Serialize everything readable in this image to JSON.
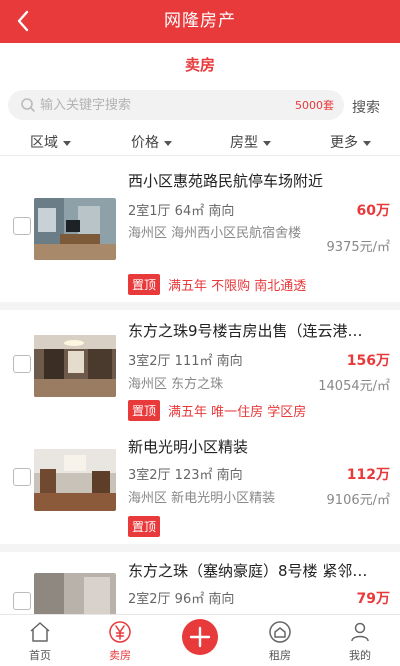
{
  "header": {
    "title": "网隆房产"
  },
  "section_title": "卖房",
  "search": {
    "placeholder": "输入关键字搜索",
    "count": "5000套",
    "button": "搜索"
  },
  "filters": [
    {
      "label": "区域"
    },
    {
      "label": "价格"
    },
    {
      "label": "房型"
    },
    {
      "label": "更多"
    }
  ],
  "listings": [
    {
      "title": "西小区惠苑路民航停车场附近",
      "specs": "2室1厅 64㎡ 南向",
      "price": "60万",
      "location": "海州区 海州西小区民航宿舍楼",
      "unit_price": "9375元/㎡",
      "badge": "置顶",
      "tags": "满五年 不限购 南北通透"
    },
    {
      "title": "东方之珠9号楼吉房出售（连云港…",
      "specs": "3室2厅 111㎡ 南向",
      "price": "156万",
      "location": "海州区 东方之珠",
      "unit_price": "14054元/㎡",
      "badge": "置顶",
      "tags": "满五年 唯一住房 学区房"
    },
    {
      "title": "新电光明小区精装",
      "specs": "3室2厅 123㎡ 南向",
      "price": "112万",
      "location": "海州区 新电光明小区精装",
      "unit_price": "9106元/㎡",
      "badge": "置顶",
      "tags": ""
    },
    {
      "title": "东方之珠（塞纳豪庭）8号楼 紧邻…",
      "specs": "2室2厅 96㎡ 南向",
      "price": "79万",
      "location": "",
      "unit_price": "",
      "badge": "",
      "tags": ""
    }
  ],
  "tabbar": {
    "home": "首页",
    "sell": "卖房",
    "rent": "租房",
    "mine": "我的"
  },
  "colors": {
    "accent": "#e8393b"
  }
}
